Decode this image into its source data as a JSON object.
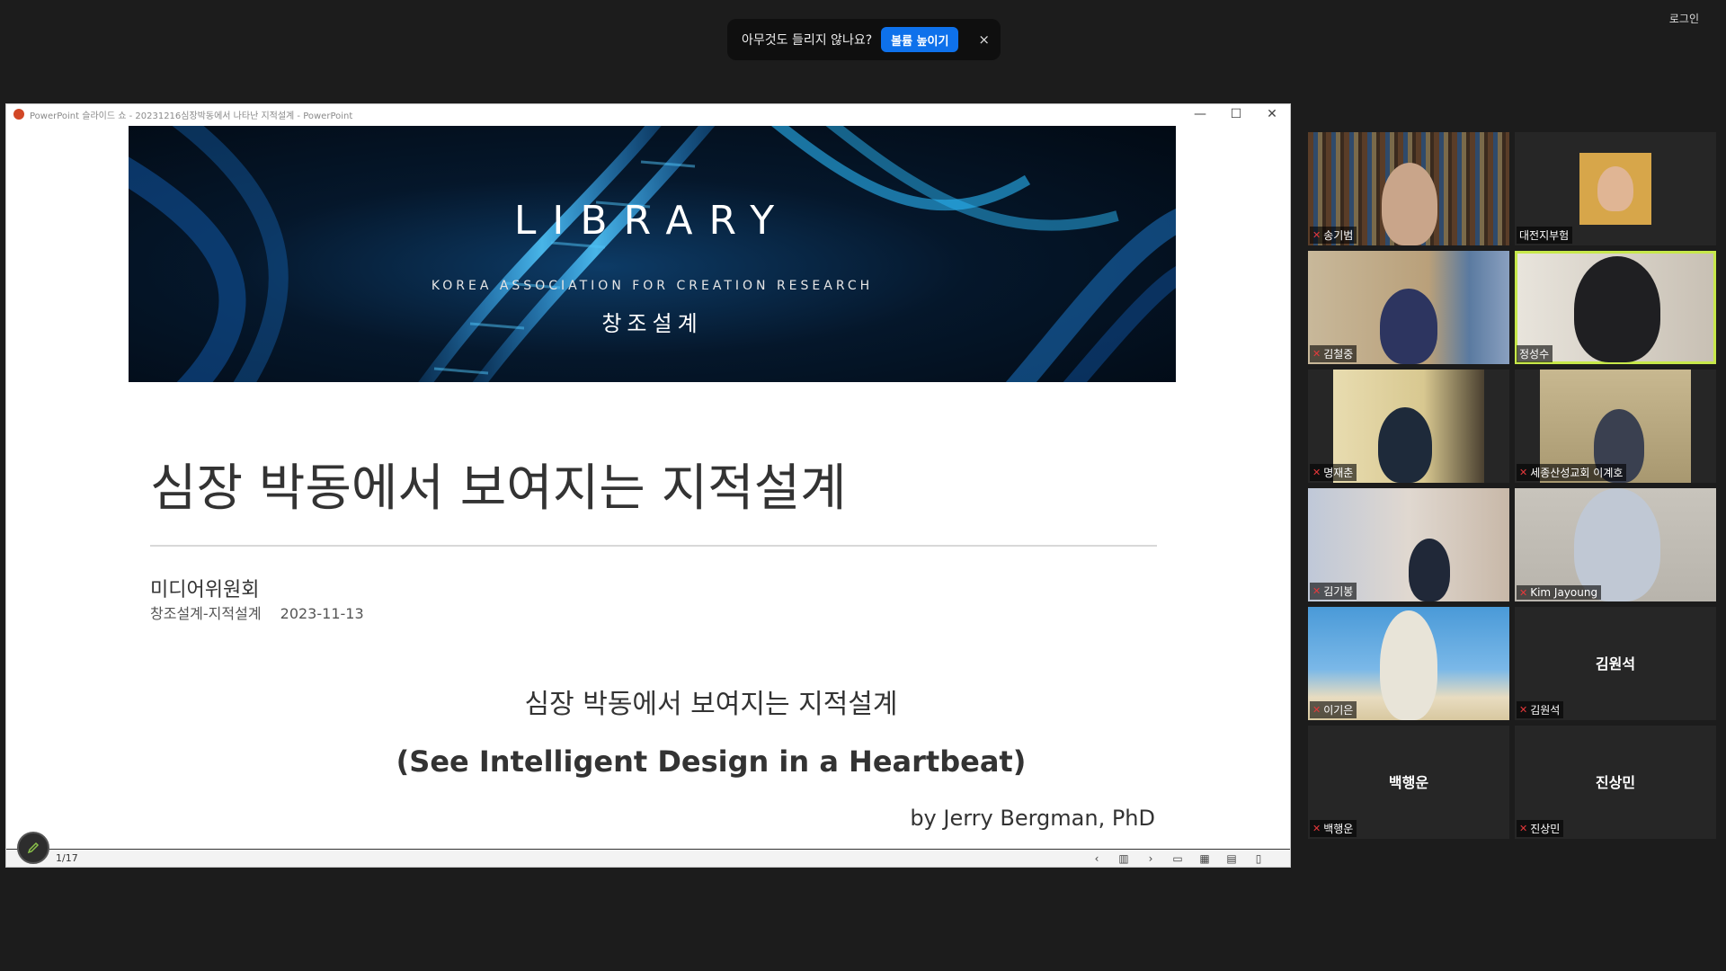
{
  "notification": {
    "message": "아무것도 들리지 않나요?",
    "button_label": "볼륨 높이기",
    "close_label": "×"
  },
  "login_label": "로그인",
  "ppt": {
    "window_title": "PowerPoint 슬라이드 쇼 - 20231216심장박동에서 나타난 지적설계 - PowerPoint",
    "controls": {
      "minimize": "—",
      "maximize": "☐",
      "close": "✕"
    },
    "banner": {
      "title": "LIBRARY",
      "subtitle": "KOREA  ASSOCIATION FOR CREATION RESEARCH",
      "korean": "창조설계"
    },
    "slide": {
      "title": "심장 박동에서 보여지는 지적설계",
      "department": "미디어위원회",
      "category": "창조설계-지적설계",
      "date": "2023-11-13",
      "korean_title": "심장 박동에서 보여지는 지적설계",
      "english_title": "(See Intelligent Design in a Heartbeat)",
      "author": "by Jerry Bergman, PhD"
    },
    "statusbar": {
      "page_indicator": "1/17",
      "icons": [
        "‹",
        "▥",
        "›",
        "▭",
        "▦",
        "▤",
        "▯"
      ]
    }
  },
  "participants": [
    {
      "name": "송기범",
      "video": true,
      "muted": true,
      "active": false
    },
    {
      "name": "대전지부험",
      "video": true,
      "muted": false,
      "active": false
    },
    {
      "name": "김철중",
      "video": true,
      "muted": true,
      "active": false
    },
    {
      "name": "정성수",
      "video": true,
      "muted": false,
      "active": true
    },
    {
      "name": "명재춘",
      "video": true,
      "muted": true,
      "active": false
    },
    {
      "name": "세종산성교회 이계호",
      "video": true,
      "muted": true,
      "active": false
    },
    {
      "name": "김기봉",
      "video": true,
      "muted": true,
      "active": false
    },
    {
      "name": "Kim Jayoung",
      "video": true,
      "muted": true,
      "active": false
    },
    {
      "name": "이기은",
      "video": true,
      "muted": true,
      "active": false
    },
    {
      "name": "김원석",
      "video": false,
      "muted": true,
      "active": false
    },
    {
      "name": "백행운",
      "video": false,
      "muted": true,
      "active": false
    },
    {
      "name": "진상민",
      "video": false,
      "muted": true,
      "active": false
    }
  ],
  "colors": {
    "accent_blue": "#0e71eb",
    "active_speaker": "#c7e84a",
    "muted_red": "#e5383b"
  }
}
